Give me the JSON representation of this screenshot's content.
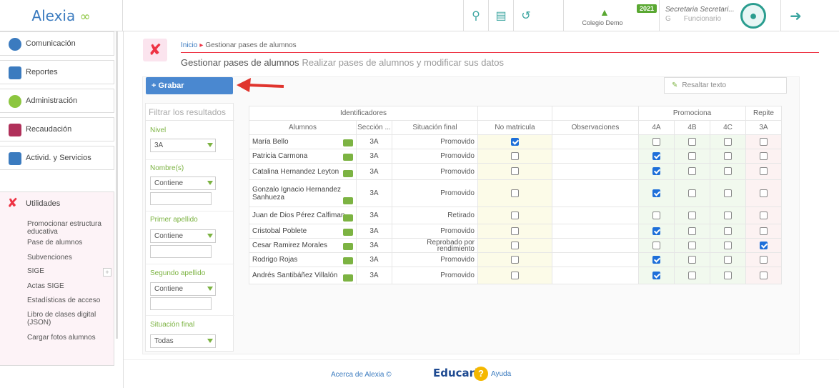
{
  "app": {
    "logo": "Alexia",
    "leaf": "∞"
  },
  "topbar": {
    "colegio": "Colegio Demo",
    "year": "2021",
    "user_name": "Secretaria Secretari...",
    "user_role": "Funcionario"
  },
  "sidebar": {
    "items": [
      {
        "label": "Comunicación",
        "icon": "chat-icon",
        "color": "#3b7bbf"
      },
      {
        "label": "Reportes",
        "icon": "report-icon",
        "color": "#3b7bbf"
      },
      {
        "label": "Administración",
        "icon": "gears-icon",
        "color": "#8cc63f"
      },
      {
        "label": "Recaudación",
        "icon": "cash-icon",
        "color": "#b0305a"
      },
      {
        "label": "Activid. y Servicios",
        "icon": "calendar-icon",
        "color": "#3b7bbf"
      }
    ],
    "utilidades": {
      "label": "Utilidades",
      "subitems": [
        "Promocionar estructura educativa",
        "Pase de alumnos",
        "Subvenciones",
        "SIGE",
        "Actas SIGE",
        "Estadísticas de acceso",
        "Libro de clases digital (JSON)",
        "Cargar fotos alumnos"
      ],
      "plus": "+"
    }
  },
  "page": {
    "breadcrumb_home": "Inicio",
    "breadcrumb_current": "Gestionar pases de alumnos",
    "title": "Gestionar pases de alumnos",
    "subtitle": "Realizar pases de alumnos y modificar sus datos",
    "grabar": "Grabar",
    "resaltar": "Resaltar texto"
  },
  "filters": {
    "search_placeholder": "Filtrar los resultados",
    "nivel_label": "Nivel",
    "nivel_value": "3A",
    "nombre_label": "Nombre(s)",
    "nombre_op": "Contiene",
    "ap1_label": "Primer apellido",
    "ap1_op": "Contiene",
    "ap2_label": "Segundo apellido",
    "ap2_op": "Contiene",
    "sit_label": "Situación final",
    "sit_value": "Todas"
  },
  "table": {
    "group_headers": {
      "identificadores": "Identificadores",
      "promociona": "Promociona",
      "repite": "Repite"
    },
    "headers": {
      "alumnos": "Alumnos",
      "seccion": "Sección ...",
      "situacion": "Situación final",
      "nomat": "No matricula",
      "obs": "Observaciones",
      "p4a": "4A",
      "p4b": "4B",
      "p4c": "4C",
      "r3a": "3A"
    },
    "rows": [
      {
        "name": "María Bello",
        "sec": "3A",
        "sit": "Promovido",
        "nomat": true,
        "p4a": false,
        "p4b": false,
        "p4c": false,
        "r3a": false
      },
      {
        "name": "Patricia Carmona",
        "sec": "3A",
        "sit": "Promovido",
        "nomat": false,
        "p4a": true,
        "p4b": false,
        "p4c": false,
        "r3a": false
      },
      {
        "name": "Catalina Hernandez Leyton",
        "sec": "3A",
        "sit": "Promovido",
        "nomat": false,
        "p4a": true,
        "p4b": false,
        "p4c": false,
        "r3a": false
      },
      {
        "name": "Gonzalo Ignacio Hernandez Sanhueza",
        "sec": "3A",
        "sit": "Promovido",
        "nomat": false,
        "p4a": true,
        "p4b": false,
        "p4c": false,
        "r3a": false
      },
      {
        "name": "Juan de Dios Pérez Calfiman",
        "sec": "3A",
        "sit": "Retirado",
        "nomat": false,
        "p4a": false,
        "p4b": false,
        "p4c": false,
        "r3a": false
      },
      {
        "name": "Cristobal Poblete",
        "sec": "3A",
        "sit": "Promovido",
        "nomat": false,
        "p4a": true,
        "p4b": false,
        "p4c": false,
        "r3a": false
      },
      {
        "name": "Cesar Ramirez Morales",
        "sec": "3A",
        "sit": "Reprobado por rendimiento",
        "nomat": false,
        "p4a": false,
        "p4b": false,
        "p4c": false,
        "r3a": true
      },
      {
        "name": "Rodrigo Rojas",
        "sec": "3A",
        "sit": "Promovido",
        "nomat": false,
        "p4a": true,
        "p4b": false,
        "p4c": false,
        "r3a": false
      },
      {
        "name": "Andrés Santibáñez Villalón",
        "sec": "3A",
        "sit": "Promovido",
        "nomat": false,
        "p4a": true,
        "p4b": false,
        "p4c": false,
        "r3a": false
      }
    ]
  },
  "footer": {
    "acerca": "Acerca de Alexia ©",
    "educaria": "Educaria",
    "ayuda": "Ayuda",
    "help_glyph": "?"
  }
}
